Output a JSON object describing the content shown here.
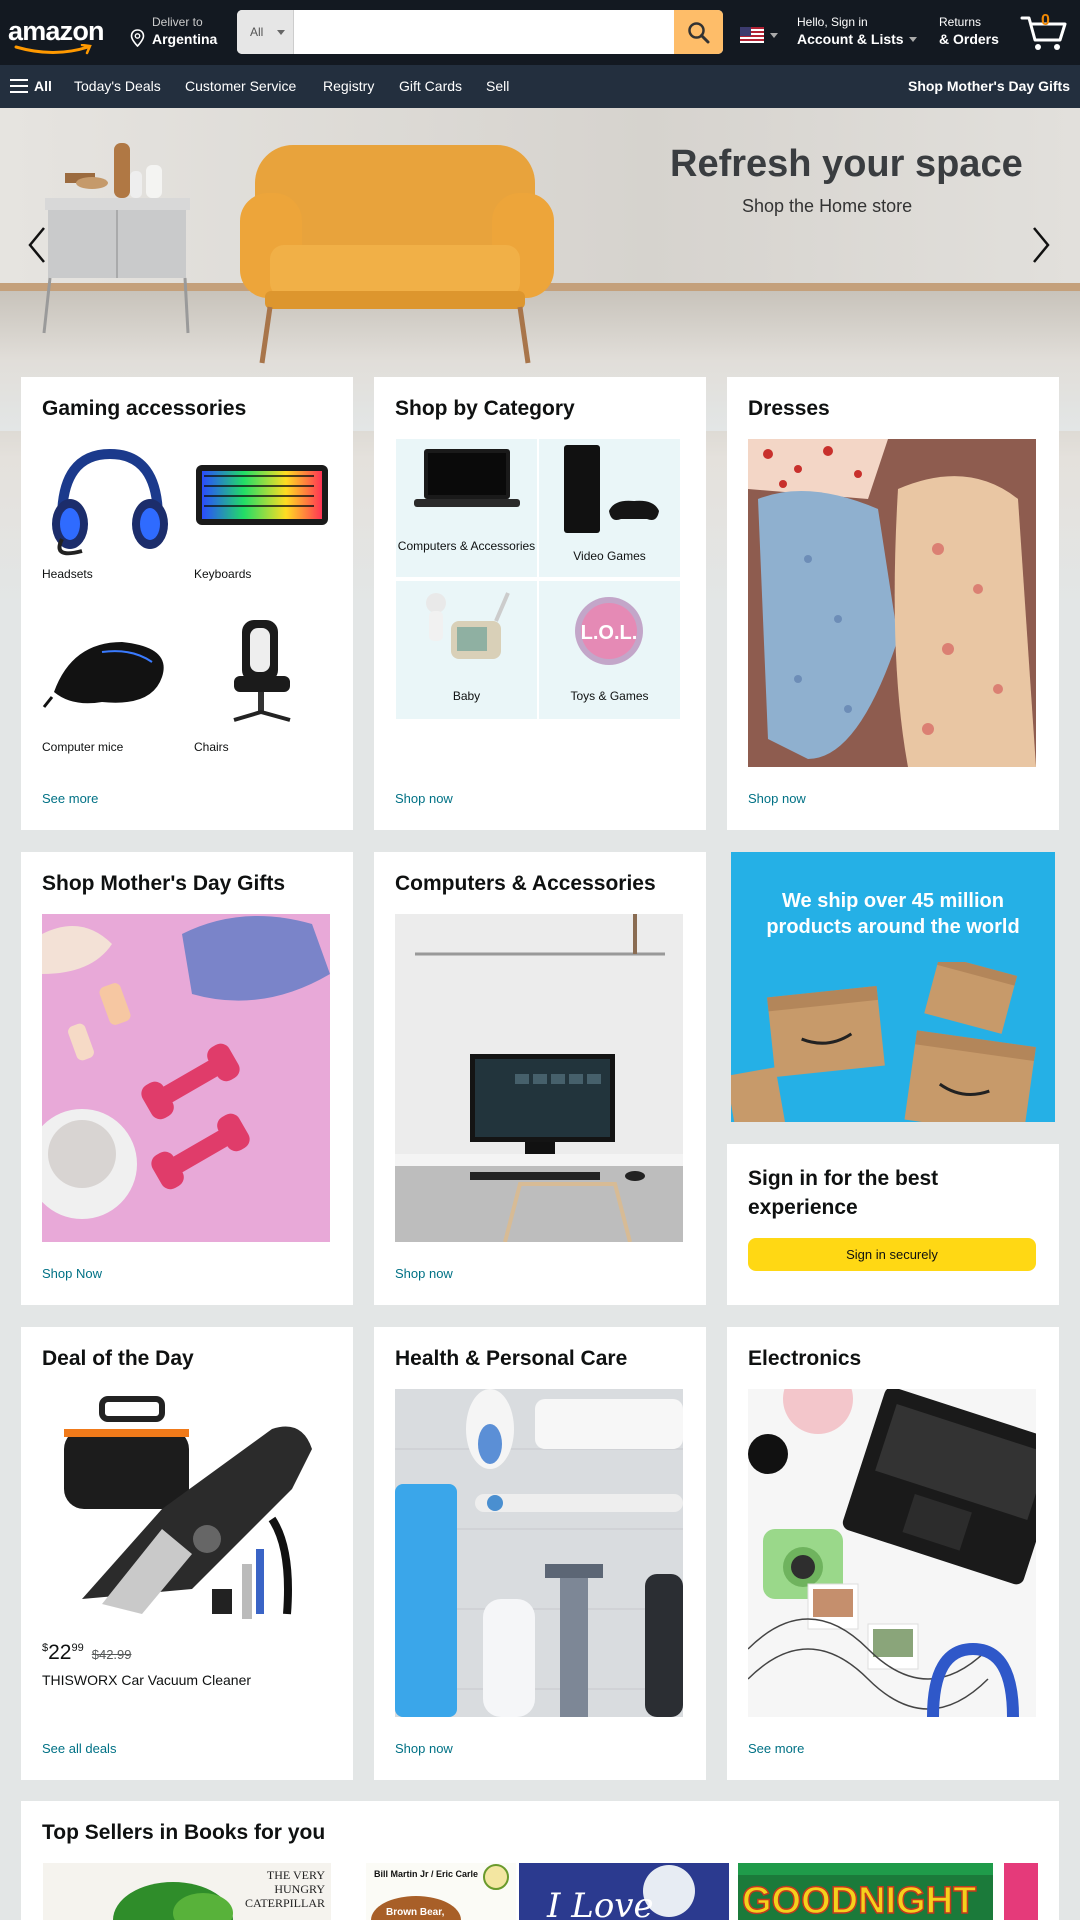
{
  "nav": {
    "logo": "amazon",
    "deliver_line1": "Deliver to",
    "deliver_line2": "Argentina",
    "search_category": "All",
    "search_placeholder": "",
    "account_line1": "Hello, Sign in",
    "account_line2": "Account & Lists",
    "returns_line1": "Returns",
    "returns_line2": "& Orders",
    "cart_count": "0"
  },
  "subnav": {
    "all": "All",
    "items": [
      "Today's Deals",
      "Customer Service",
      "Registry",
      "Gift Cards",
      "Sell"
    ],
    "promo": "Shop Mother's Day Gifts"
  },
  "hero": {
    "title": "Refresh your space",
    "subtitle": "Shop the Home store"
  },
  "cards": {
    "gaming": {
      "title": "Gaming accessories",
      "items": [
        "Headsets",
        "Keyboards",
        "Computer mice",
        "Chairs"
      ],
      "link": "See more"
    },
    "category": {
      "title": "Shop by Category",
      "items": [
        "Computers & Accessories",
        "Video Games",
        "Baby",
        "Toys & Games"
      ],
      "link": "Shop now"
    },
    "dresses": {
      "title": "Dresses",
      "link": "Shop now"
    },
    "mothers": {
      "title": "Shop Mother's Day Gifts",
      "link": "Shop Now"
    },
    "computers": {
      "title": "Computers & Accessories",
      "link": "Shop now"
    },
    "shipping": {
      "text": "We ship over 45 million products around the world"
    },
    "signin": {
      "title": "Sign in for the best experience",
      "button": "Sign in securely"
    },
    "deal": {
      "title": "Deal of the Day",
      "price_symbol": "$",
      "price_whole": "22",
      "price_cents": "99",
      "old_price": "$42.99",
      "product": "THISWORX Car Vacuum Cleaner",
      "link": "See all deals"
    },
    "health": {
      "title": "Health & Personal Care",
      "link": "Shop now"
    },
    "electronics": {
      "title": "Electronics",
      "link": "See more"
    },
    "books": {
      "title": "Top Sellers in Books for you"
    }
  },
  "colors": {
    "nav_dark": "#131921",
    "nav_secondary": "#232f3e",
    "search_button": "#febd69",
    "link": "#007185",
    "signin_button": "#ffd814",
    "cart_count": "#f08804"
  }
}
